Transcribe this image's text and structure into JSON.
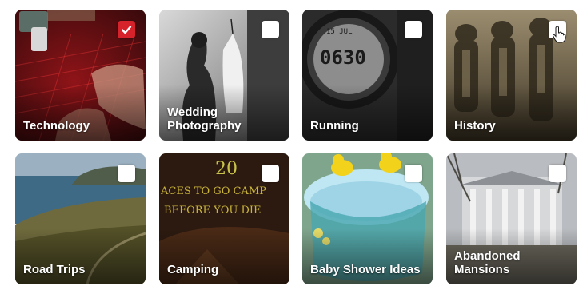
{
  "interests": [
    {
      "label": "Technology",
      "selected": true,
      "check_icon": "checkmark-icon"
    },
    {
      "label": "Wedding Photography",
      "selected": false
    },
    {
      "label": "Running",
      "selected": false,
      "watch_text": "0630",
      "watch_date": "15 JUL"
    },
    {
      "label": "History",
      "selected": false
    },
    {
      "label": "Road Trips",
      "selected": false
    },
    {
      "label": "Camping",
      "selected": false,
      "poster_number": "20",
      "poster_line1": "ACES TO GO CAMP",
      "poster_line2": "BEFORE YOU DIE"
    },
    {
      "label": "Baby Shower Ideas",
      "selected": false
    },
    {
      "label": "Abandoned Mansions",
      "selected": false
    }
  ],
  "colors": {
    "accent": "#d6232b",
    "checkbox": "#ffffff"
  },
  "cursor_icon": "hand-pointer-icon"
}
